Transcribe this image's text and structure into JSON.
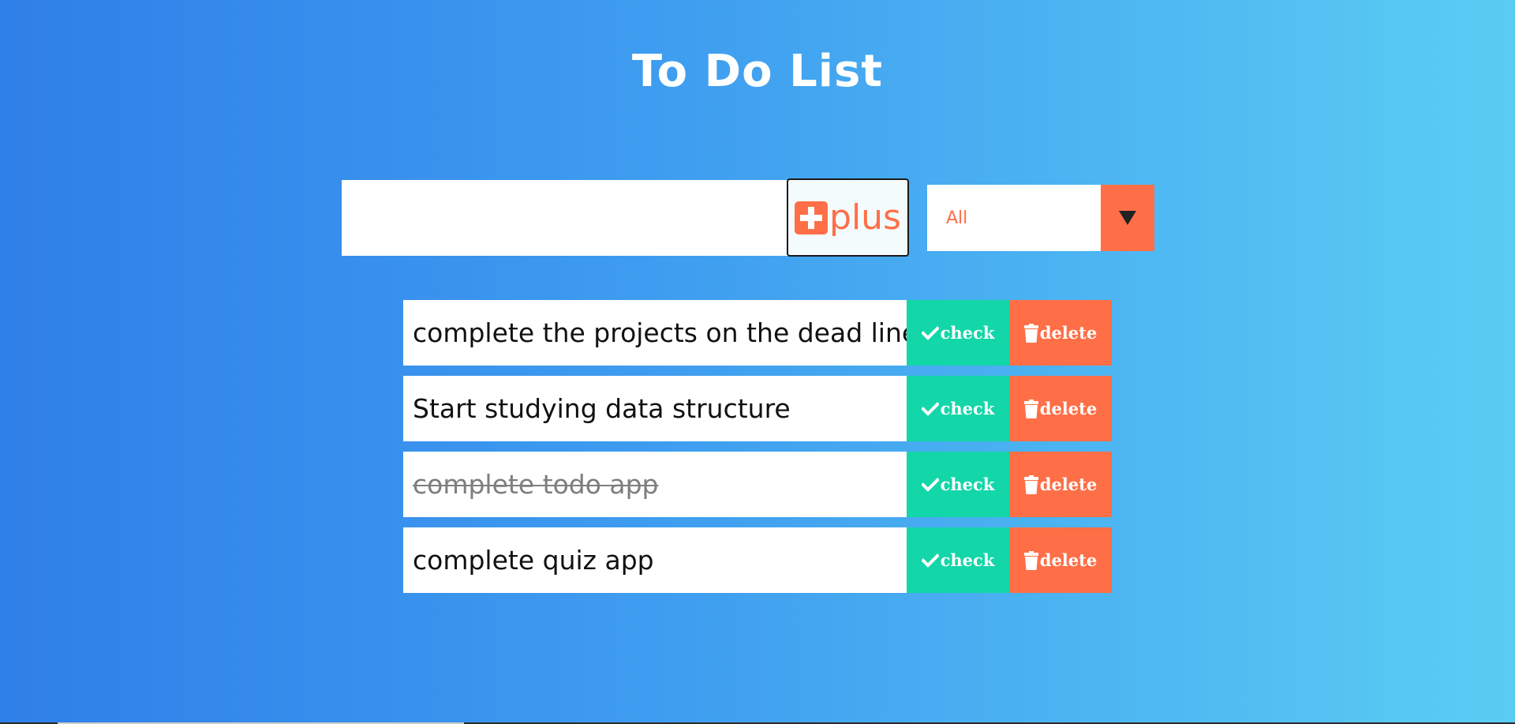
{
  "app": {
    "title": "To Do List"
  },
  "form": {
    "input_value": "",
    "add_button_label": "plus",
    "add_icon": "plus-square-icon"
  },
  "filter": {
    "selected": "All",
    "arrow_icon": "caret-down-icon"
  },
  "todos": [
    {
      "text": "complete the projects on the dead line",
      "completed": false,
      "check_label": "check",
      "delete_label": "delete"
    },
    {
      "text": "Start studying data structure",
      "completed": false,
      "check_label": "check",
      "delete_label": "delete"
    },
    {
      "text": "complete todo app",
      "completed": true,
      "check_label": "check",
      "delete_label": "delete"
    },
    {
      "text": "complete quiz app",
      "completed": false,
      "check_label": "check",
      "delete_label": "delete"
    }
  ],
  "colors": {
    "gradient_start": "#2f7fe8",
    "gradient_end": "#5acdf3",
    "accent": "#ff6f47",
    "check": "#13d6a9"
  }
}
